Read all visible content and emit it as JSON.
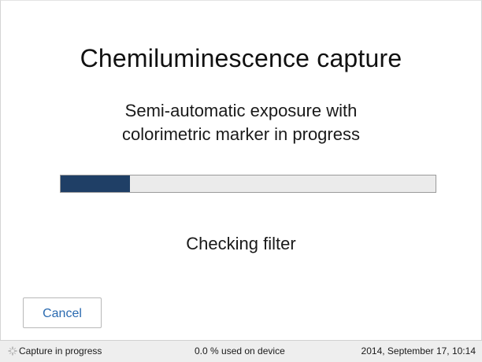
{
  "dialog": {
    "title": "Chemiluminescence capture",
    "subtitle_line1": "Semi-automatic exposure with",
    "subtitle_line2": "colorimetric marker in progress",
    "progress_fraction": 0.185,
    "progress_color": "#1f3f66",
    "step_text": "Checking filter",
    "cancel_label": "Cancel"
  },
  "status_bar": {
    "activity_icon": "spinner-icon",
    "activity_text": "Capture in progress",
    "storage_text": "0.0 % used on device",
    "datetime_text": "2014, September 17, 10:14"
  }
}
